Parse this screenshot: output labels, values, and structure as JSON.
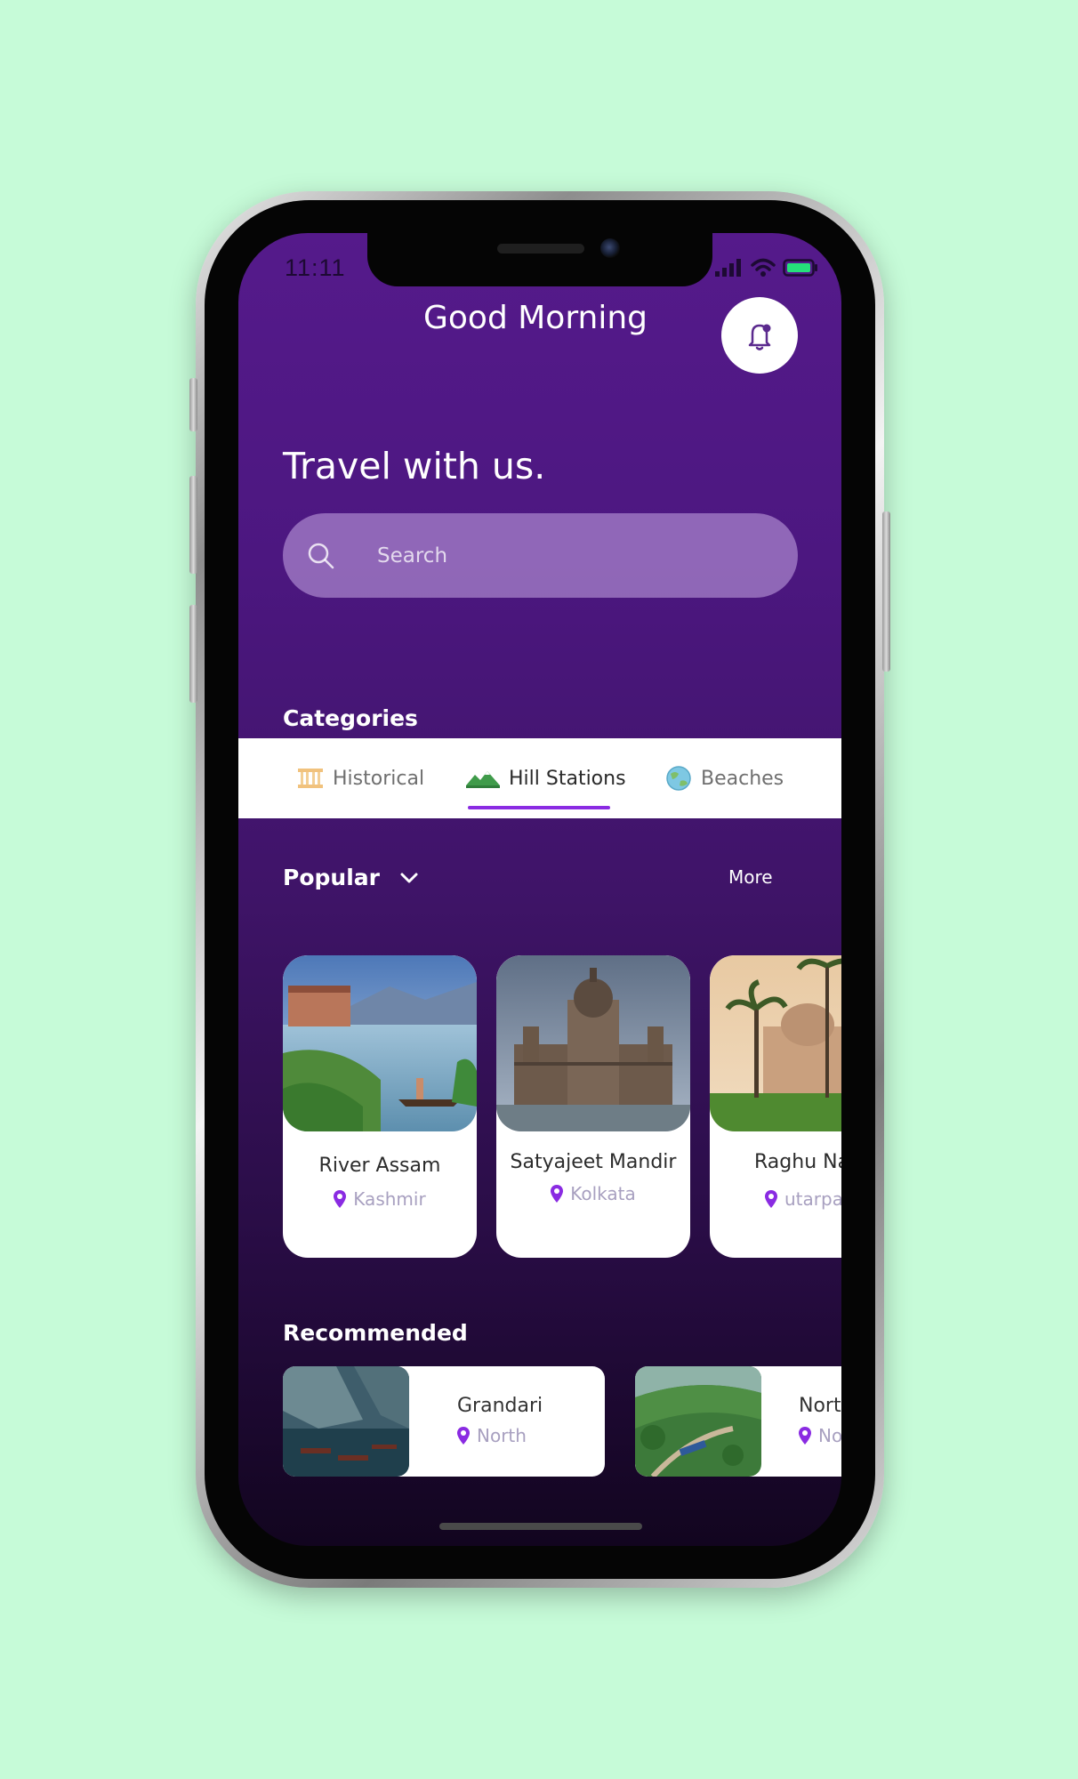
{
  "status_bar": {
    "time": "11:11"
  },
  "header": {
    "greeting": "Good Morning"
  },
  "hero": {
    "headline": "Travel with us."
  },
  "search": {
    "placeholder": "Search"
  },
  "categories": {
    "title": "Categories",
    "items": [
      {
        "label": "Historical",
        "icon": "monument-icon"
      },
      {
        "label": "Hill Stations",
        "icon": "mountain-icon",
        "active": true
      },
      {
        "label": "Beaches",
        "icon": "globe-icon"
      }
    ]
  },
  "popular": {
    "title": "Popular",
    "more_label": "More",
    "cards": [
      {
        "name": "River Assam",
        "location": "Kashmir"
      },
      {
        "name": "Satyajeet Mandir",
        "location": "Kolkata"
      },
      {
        "name": "Raghu Na",
        "location": "utarpa"
      }
    ]
  },
  "recommended": {
    "title": "Recommended",
    "cards": [
      {
        "name": "Grandari",
        "location": "North"
      },
      {
        "name": "Nort",
        "location": "No"
      }
    ]
  },
  "colors": {
    "page_background": "#c6fbd8",
    "screen_top": "#551a8b",
    "screen_bottom": "#12051f",
    "accent": "#8a2be2"
  }
}
